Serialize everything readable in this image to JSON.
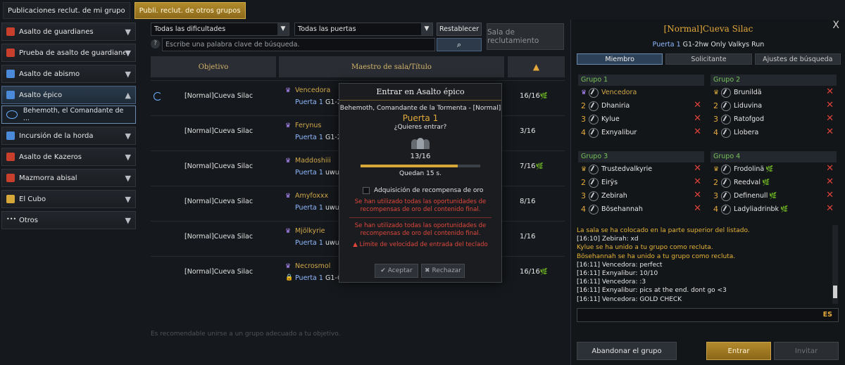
{
  "top_tabs": {
    "my_group": "Publicaciones reclut. de mi grupo",
    "other_groups": "Publi. reclut. de otros grupos"
  },
  "sidebar": {
    "items": [
      {
        "label": "Asalto de guardianes",
        "icon": "guardian-icon",
        "color": "#c8402c"
      },
      {
        "label": "Prueba de asalto de guardianes",
        "icon": "guardian-trial-icon",
        "color": "#c8402c"
      },
      {
        "label": "Asalto de abismo",
        "icon": "abyss-icon",
        "color": "#4a8ad8"
      },
      {
        "label": "Asalto épico",
        "icon": "epic-raid-icon",
        "color": "#4a8ad8"
      },
      {
        "label": "Incursión de la horda",
        "icon": "horde-icon",
        "color": "#4a8ad8"
      },
      {
        "label": "Asalto de Kazeros",
        "icon": "kazeros-icon",
        "color": "#c8402c"
      },
      {
        "label": "Mazmorra abisal",
        "icon": "abyssal-dungeon-icon",
        "color": "#c8402c"
      },
      {
        "label": "El Cubo",
        "icon": "cube-icon",
        "color": "#d6a83a"
      },
      {
        "label": "Otros",
        "icon": "more-icon",
        "color": "#dddddd"
      }
    ],
    "subitem": "Behemoth, el Comandante de ..."
  },
  "filters": {
    "difficulty": "Todas las dificultades",
    "gates": "Todas las puertas",
    "reset": "Restablecer",
    "search_placeholder": "Escribe una palabra clave de búsqueda.",
    "help": "?",
    "search_icon": "⌕"
  },
  "recruit_hall": "Sala de reclutamiento",
  "table": {
    "headers": {
      "objective": "Objetivo",
      "master": "Maestro de sala/Título"
    },
    "rows": [
      {
        "objective": "[Normal]Cueva Silac",
        "leader": "Vencedora",
        "gate": "Puerta 1",
        "title": " G1-2h",
        "count": "16/16",
        "leaf": "🌿"
      },
      {
        "objective": "[Normal]Cueva Silac",
        "leader": "Ferynus",
        "gate": "Puerta 1",
        "title": " G1-2h",
        "count": "3/16",
        "leaf": ""
      },
      {
        "objective": "[Normal]Cueva Silac",
        "leader": "Maddoshiii",
        "gate": "Puerta 1",
        "title": " uwu",
        "count": "7/16",
        "leaf": "🌿"
      },
      {
        "objective": "[Normal]Cueva Silac",
        "leader": "Amyfoxxx",
        "gate": "Puerta 1",
        "title": " uwu",
        "count": "8/16",
        "leaf": ""
      },
      {
        "objective": "[Normal]Cueva Silac",
        "leader": "Mjölkyrie",
        "gate": "Puerta 1",
        "title": " uwu",
        "count": "1/16",
        "leaf": ""
      },
      {
        "objective": "[Normal]Cueva Silac",
        "leader": "Necrosmol",
        "gate": "Puerta 1",
        "title": " G1-G",
        "count": "16/16",
        "leaf": "🌿"
      }
    ]
  },
  "footer_note": "Es recomendable unirse a un grupo adecuado a tu objetivo.",
  "modal": {
    "title": "Entrar en Asalto épico",
    "subtitle": "Behemoth, Comandante de la Tormenta - [Normal]",
    "gate": "Puerta 1",
    "ask": "¿Quieres entrar?",
    "count": "13/16",
    "progress": 0.8125,
    "time_left": "Quedan 15 s.",
    "gold_option": "Adquisición de recompensa de oro",
    "warning_1": "Se han utilizado todas las oportunidades de recompensas de oro del contenido final.",
    "warning_2": "Se han utilizado todas las oportunidades de recompensas de oro del contenido final.",
    "limit": "Límite de velocidad de entrada del teclado",
    "accept": "Aceptar",
    "reject": "Rechazar"
  },
  "panel": {
    "close": "X",
    "title_diff": "[Normal]",
    "title_name": "Cueva Silac",
    "sub_gate": "Puerta 1",
    "sub_title": " G1-2hw Only Valkys Run",
    "tabs": [
      "Miembro",
      "Solicitante",
      "Ajustes de búsqueda"
    ],
    "groups": [
      {
        "name": "Grupo 1",
        "members": [
          {
            "num": "",
            "name": "Vencedora",
            "leader": true,
            "kick": false,
            "leaf": false
          },
          {
            "num": "2",
            "name": "Dhaniria",
            "leader": false,
            "kick": true,
            "leaf": false
          },
          {
            "num": "3",
            "name": "Kylue",
            "leader": false,
            "kick": true,
            "leaf": false
          },
          {
            "num": "4",
            "name": "Exnyalibur",
            "leader": false,
            "kick": true,
            "leaf": false
          }
        ]
      },
      {
        "name": "Grupo 2",
        "members": [
          {
            "num": "",
            "name": "Brunildä",
            "leader": false,
            "kick": true,
            "leaf": false
          },
          {
            "num": "2",
            "name": "Liduvina",
            "leader": false,
            "kick": true,
            "leaf": false
          },
          {
            "num": "3",
            "name": "Ratofgod",
            "leader": false,
            "kick": true,
            "leaf": false
          },
          {
            "num": "4",
            "name": "Llobera",
            "leader": false,
            "kick": true,
            "leaf": false
          }
        ]
      },
      {
        "name": "Grupo 3",
        "members": [
          {
            "num": "",
            "name": "Trustedvalkyrie",
            "leader": false,
            "kick": true,
            "leaf": false
          },
          {
            "num": "2",
            "name": "Eirÿs",
            "leader": false,
            "kick": true,
            "leaf": false
          },
          {
            "num": "3",
            "name": "Zebirah",
            "leader": false,
            "kick": true,
            "leaf": false
          },
          {
            "num": "4",
            "name": "Bösehannah",
            "leader": false,
            "kick": true,
            "leaf": false
          }
        ]
      },
      {
        "name": "Grupo 4",
        "members": [
          {
            "num": "",
            "name": "Frodolinä",
            "leader": false,
            "kick": true,
            "leaf": true
          },
          {
            "num": "2",
            "name": "Reedval",
            "leader": false,
            "kick": true,
            "leaf": true
          },
          {
            "num": "3",
            "name": "Definenull",
            "leader": false,
            "kick": true,
            "leaf": true
          },
          {
            "num": "4",
            "name": "Ladyliadrinbk",
            "leader": false,
            "kick": true,
            "leaf": true
          }
        ]
      }
    ],
    "chat": [
      {
        "text": "La sala se ha colocado en la parte superior del listado.",
        "sys": true
      },
      {
        "text": "[16:10] Zebirah: xd",
        "sys": false
      },
      {
        "text": "Kylue se ha unido a tu grupo como recluta.",
        "sys": true
      },
      {
        "text": "Bösehannah se ha unido a tu grupo como recluta.",
        "sys": true
      },
      {
        "text": "[16:11] Vencedora: perfect",
        "sys": false
      },
      {
        "text": "[16:11] Exnyalibur: 10/10",
        "sys": false
      },
      {
        "text": "[16:11] Vencedora: :3",
        "sys": false
      },
      {
        "text": "[16:11] Exnyalibur: pics at the end. dont go <3",
        "sys": false
      },
      {
        "text": "[16:11] Vencedora: GOLD CHECK",
        "sys": false
      }
    ],
    "chat_lang": "ES",
    "leave": "Abandonar el grupo",
    "enter": "Entrar",
    "invite": "Invitar"
  }
}
